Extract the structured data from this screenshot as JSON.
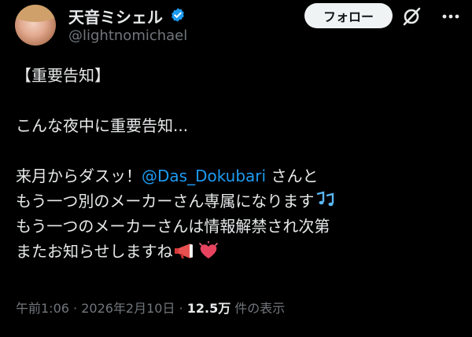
{
  "author": {
    "display_name": "天音ミシェル",
    "handle": "@lightnomichael"
  },
  "actions": {
    "follow_label": "フォロー"
  },
  "tweet": {
    "lines": [
      "【重要告知】",
      "",
      "こんな夜中に重要告知...",
      "",
      "来月から",
      "もう一つ別のメーカーさん専属になります",
      "もう一つのメーカーさんは情報解禁され次第",
      "またお知らせしますね"
    ],
    "line5_prefix": "来月からダスッ！",
    "mention": "@Das_Dokubari",
    "line5_suffix": " さんと"
  },
  "meta": {
    "time": "午前1:06",
    "sep1": " · ",
    "date": "2026年2月10日",
    "sep2": " · ",
    "views_count": "12.5万",
    "views_label": " 件の表示"
  },
  "colors": {
    "background": "#000000",
    "text": "#e7e9ea",
    "secondary": "#71767b",
    "link": "#1d9bf0",
    "verified": "#1d9bf0"
  },
  "icons": [
    "avatar",
    "verified-badge-icon",
    "grok-icon",
    "more-icon",
    "music-notes-icon",
    "megaphone-icon",
    "heart-icon"
  ]
}
